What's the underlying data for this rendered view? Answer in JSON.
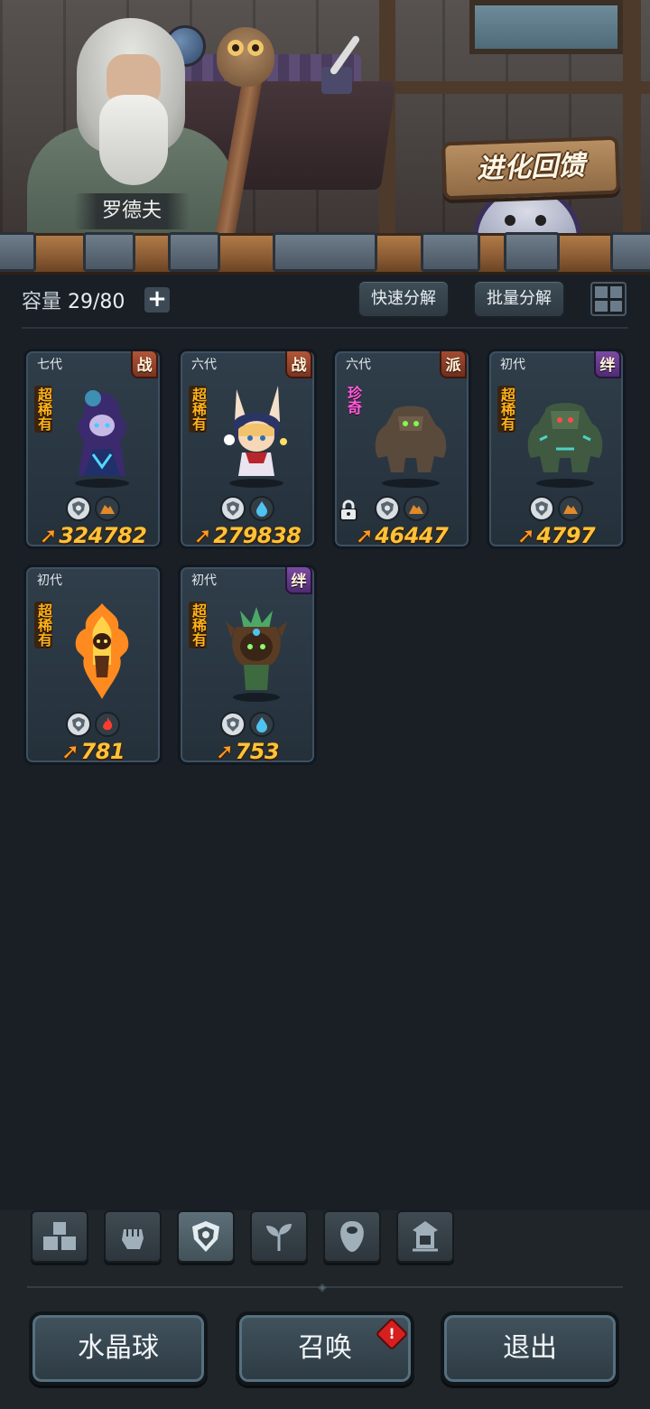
{
  "npc": {
    "name": "罗德夫"
  },
  "event": {
    "label": "进化回馈"
  },
  "toolbar": {
    "capacity_label": "容量",
    "capacity_value": "29/80",
    "add_symbol": "+",
    "quick_decompose": "快速分解",
    "batch_decompose": "批量分解"
  },
  "cards": [
    {
      "generation": "七代",
      "tag": "战",
      "rarity": "超稀有",
      "element": "earth",
      "power": "324782",
      "locked": false
    },
    {
      "generation": "六代",
      "tag": "战",
      "rarity": "超稀有",
      "element": "water",
      "power": "279838",
      "locked": false
    },
    {
      "generation": "六代",
      "tag": "派",
      "rarity": "珍奇",
      "element": "earth",
      "power": "46447",
      "locked": true
    },
    {
      "generation": "初代",
      "tag": "绊",
      "rarity": "超稀有",
      "element": "earth",
      "power": "4797",
      "locked": false
    },
    {
      "generation": "初代",
      "tag": "",
      "rarity": "超稀有",
      "element": "fire",
      "power": "781",
      "locked": false
    },
    {
      "generation": "初代",
      "tag": "绊",
      "rarity": "超稀有",
      "element": "water",
      "power": "753",
      "locked": false
    }
  ],
  "tabs": [
    "blocks-icon",
    "fist-icon",
    "shield-icon",
    "sprout-icon",
    "alien-head-icon",
    "temple-icon"
  ],
  "active_tab": 2,
  "actions": {
    "crystal_ball": "水晶球",
    "summon": "召唤",
    "summon_alert": "!",
    "exit": "退出"
  },
  "colors": {
    "power": "#ffc23a",
    "super_rare": "#ffb21a",
    "rare": "#ff5be6",
    "alert": "#d62020"
  }
}
